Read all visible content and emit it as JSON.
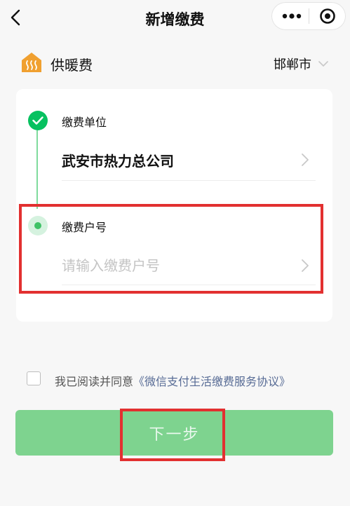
{
  "nav": {
    "title": "新增缴费"
  },
  "service": {
    "name": "供暖费",
    "city": "邯郸市"
  },
  "steps": [
    {
      "label": "缴费单位",
      "value": "武安市热力总公司"
    },
    {
      "label": "缴费户号",
      "placeholder": "请输入缴费户号",
      "value": ""
    }
  ],
  "agreement": {
    "prefix": "我已阅读并同意",
    "link": "《微信支付生活缴费服务协议》",
    "checked": false
  },
  "next_button": {
    "label": "下一步"
  },
  "colors": {
    "accent": "#07c160",
    "button_disabled": "#7ed38f",
    "highlight": "#e23030",
    "service_icon": "#f0a030",
    "link": "#576b95"
  }
}
